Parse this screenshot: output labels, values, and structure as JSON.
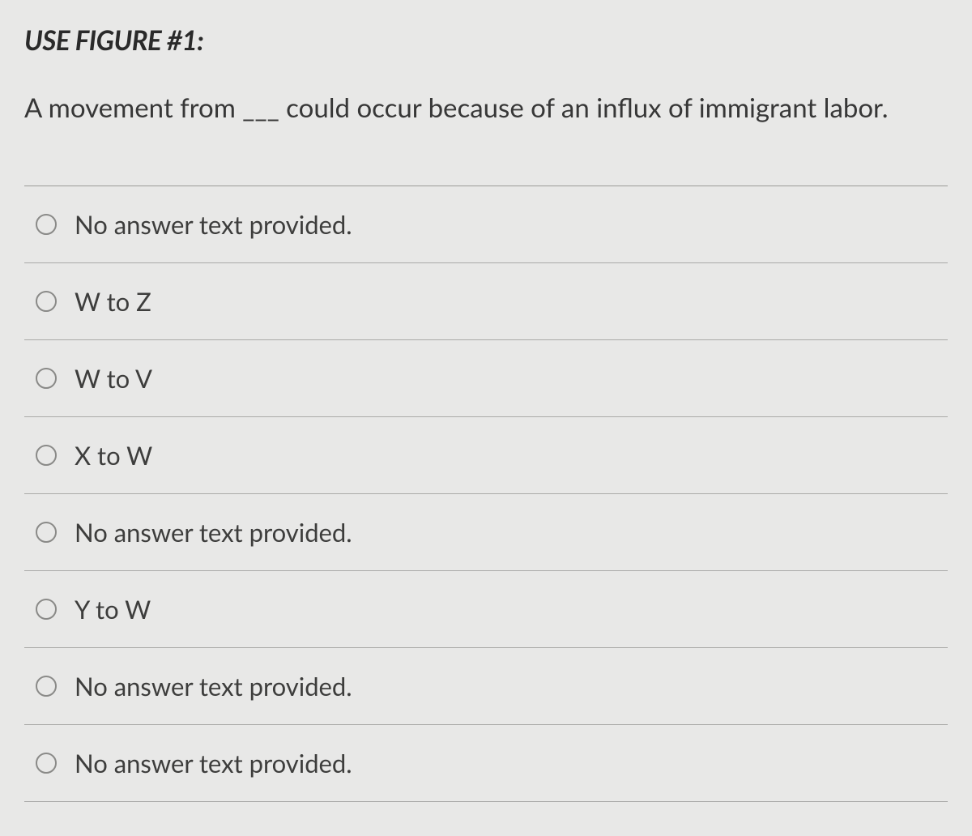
{
  "header": "USE FIGURE #1:",
  "question": "A movement from ___ could occur because of an influx of immigrant labor.",
  "options": [
    {
      "label": "No answer text provided."
    },
    {
      "label": "W to Z"
    },
    {
      "label": "W to V"
    },
    {
      "label": "X to W"
    },
    {
      "label": "No answer text provided."
    },
    {
      "label": "Y to W"
    },
    {
      "label": "No answer text provided."
    },
    {
      "label": "No answer text provided."
    }
  ]
}
